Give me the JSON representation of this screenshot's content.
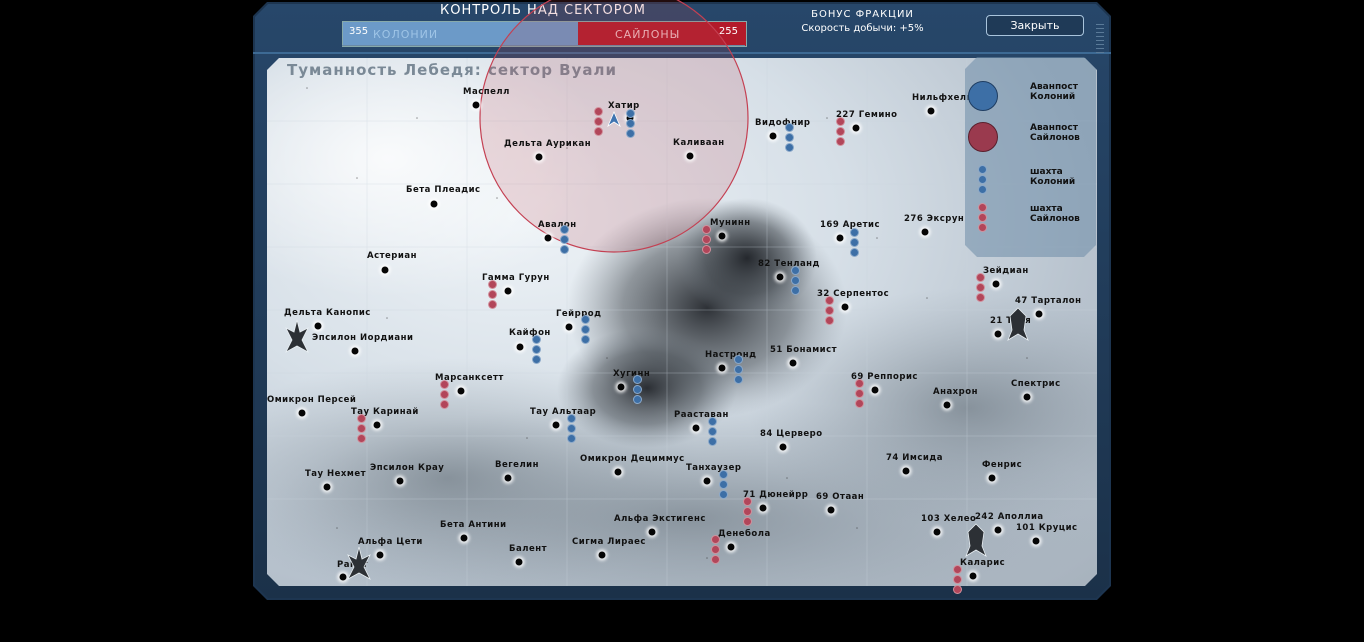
{
  "header": {
    "control_title": "КОНТРОЛЬ НАД СЕКТОРОМ",
    "colony_label": "КОЛОНИИ",
    "cylon_label": "САЙЛОНЫ",
    "colony_score": "355",
    "cylon_score": "255",
    "colony_fraction": 0.582,
    "bonus_title": "БОНУС ФРАКЦИИ",
    "bonus_value": "Скорость добычи: +5%",
    "close_label": "Закрыть"
  },
  "colors": {
    "colony": "#6c9ac8",
    "cylon": "#b31a2a",
    "frame": "#1d3550"
  },
  "map": {
    "title": "Туманность Лебедя: сектор Вуали"
  },
  "legend": {
    "colony_outpost": [
      "Аванпост",
      "Колоний"
    ],
    "cylon_outpost": [
      "Аванпост",
      "Сайлонов"
    ],
    "colony_mine": [
      "шахта",
      "Колоний"
    ],
    "cylon_mine": [
      "шахта",
      "Сайлонов"
    ]
  },
  "planets": [
    {
      "name": "Маспелл"
    },
    {
      "name": "Хатир"
    },
    {
      "name": "Дельта Аурикан"
    },
    {
      "name": "Каливаан"
    },
    {
      "name": "Видофнир"
    },
    {
      "name": "227 Гемино"
    },
    {
      "name": "Нильфхель"
    },
    {
      "name": "Бета Плеадис"
    },
    {
      "name": "Авалон"
    },
    {
      "name": "Мунинн"
    },
    {
      "name": "169 Аретис"
    },
    {
      "name": "276 Эксрун"
    },
    {
      "name": "Астериан"
    },
    {
      "name": "Гамма Гурун"
    },
    {
      "name": "82 Тенланд"
    },
    {
      "name": "Зейдиан"
    },
    {
      "name": "32 Серпентос"
    },
    {
      "name": "47 Тарталон"
    },
    {
      "name": "Дельта Канопис"
    },
    {
      "name": "Гейррод"
    },
    {
      "name": "21 Тайя"
    },
    {
      "name": "Эпсилон Иордиани"
    },
    {
      "name": "Кайфон"
    },
    {
      "name": "Настронд"
    },
    {
      "name": "51 Бонамист"
    },
    {
      "name": "Марсанксетт"
    },
    {
      "name": "Хугинн"
    },
    {
      "name": "69 Реппорис"
    },
    {
      "name": "Анахрон"
    },
    {
      "name": "Спектрис"
    },
    {
      "name": "Омикрон Персей"
    },
    {
      "name": "Тау Каринай"
    },
    {
      "name": "Тау Альтаар"
    },
    {
      "name": "Рааставан"
    },
    {
      "name": "84 Церверо"
    },
    {
      "name": "Омикрон Дециммус"
    },
    {
      "name": "74 Имсида"
    },
    {
      "name": "Тау Нехмет"
    },
    {
      "name": "Эпсилон Крау"
    },
    {
      "name": "Вегелин"
    },
    {
      "name": "Танхаузер"
    },
    {
      "name": "Фенрис"
    },
    {
      "name": "71 Дюнейрр"
    },
    {
      "name": "69 Отаан"
    },
    {
      "name": "103 Хелео"
    },
    {
      "name": "242 Аполлиа"
    },
    {
      "name": "101 Круцис"
    },
    {
      "name": "Бета Антини"
    },
    {
      "name": "Альфа Экстигенс"
    },
    {
      "name": "Альфа Цети"
    },
    {
      "name": "Денебола"
    },
    {
      "name": "Балент"
    },
    {
      "name": "Сигма Лираес"
    },
    {
      "name": "Каларис"
    },
    {
      "name": "Ракет"
    }
  ]
}
